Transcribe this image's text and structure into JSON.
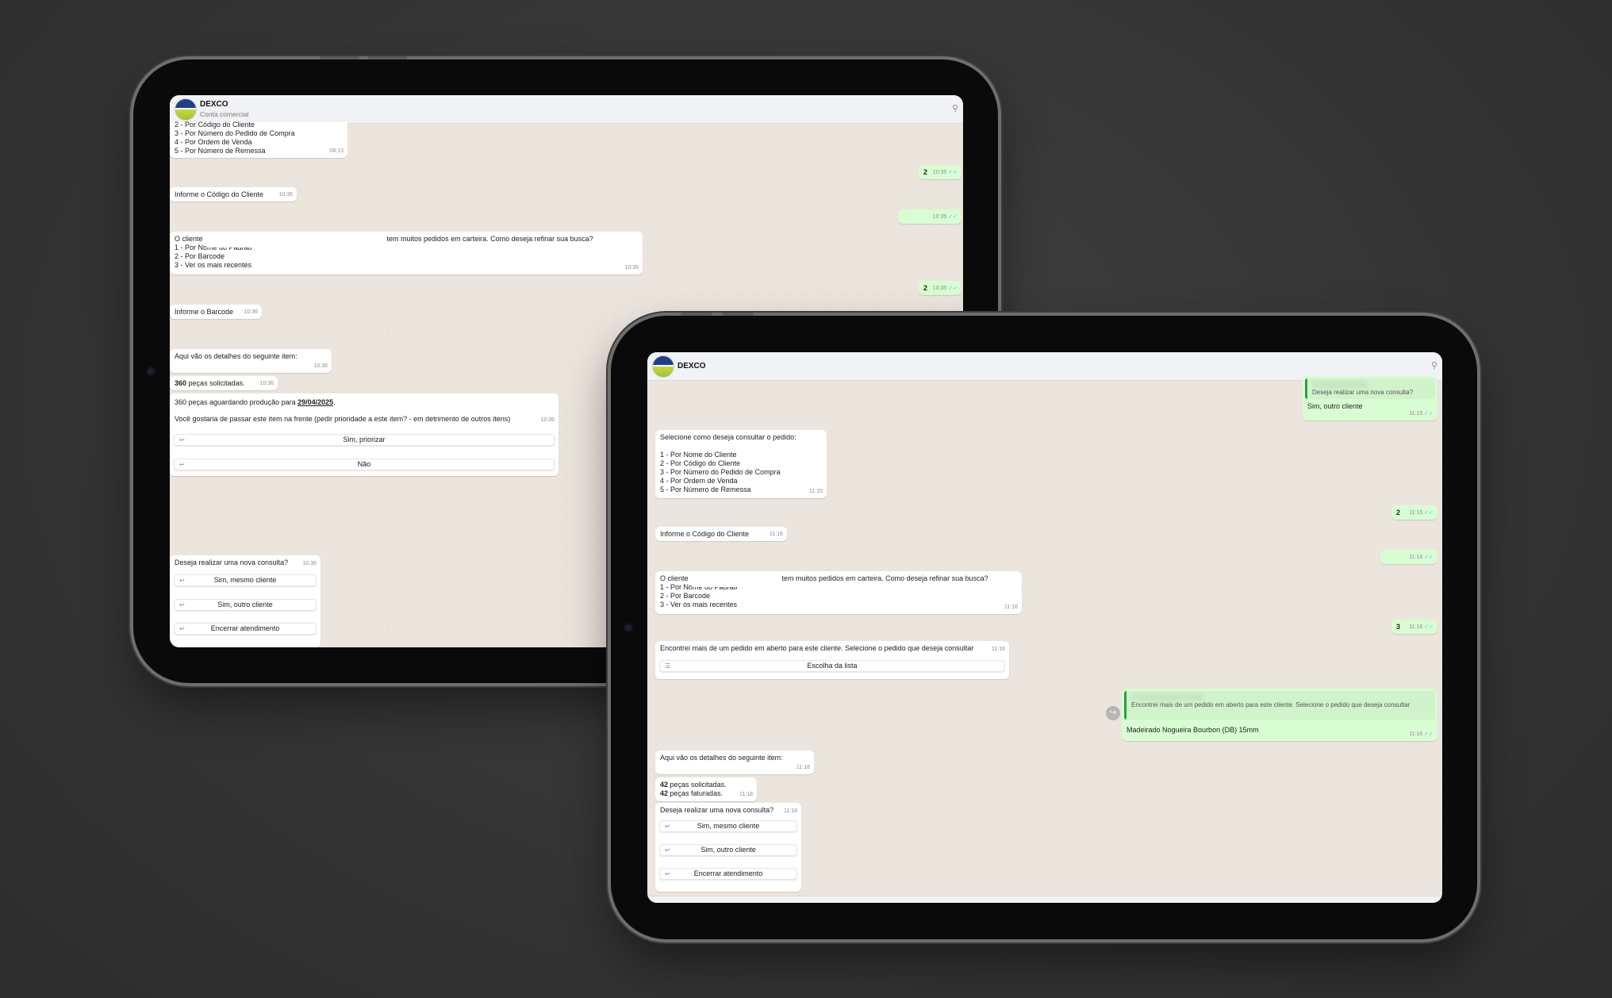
{
  "tablet1": {
    "header": {
      "name": "DEXCO",
      "subtitle": "Conta comercial"
    },
    "msgs": {
      "menu_tail": [
        "2 - Por Código do Cliente",
        "3 - Por Número do Pedido de Compra",
        "4 - Por Ordem de Venda",
        "5 - Por Número de Remessa"
      ],
      "menu_time": "08:13",
      "out_2a": "2",
      "out_2a_time": "10:35",
      "informe_codigo": "Informe o Código do Cliente",
      "informe_codigo_time": "10:35",
      "out_blank_time": "10:35",
      "refine_prefix": "O cliente",
      "refine_suffix": "tem muitos pedidos em carteira. Como deseja refinar sua busca?",
      "refine_options": [
        "1 - Por Nome do Padrão",
        "2 - Por Barcode",
        "3 - Ver os mais recentes"
      ],
      "refine_time": "10:35",
      "out_2b": "2",
      "out_2b_time": "10:35",
      "informe_barcode": "Informe o Barcode",
      "informe_barcode_time": "10:36",
      "detalhes": "Aqui vão os detalhes do seguinte item:",
      "detalhes_time": "10:36",
      "solicitadas_num": "360",
      "solicitadas_text": "peças solicitadas.",
      "solicitadas_time": "10:36",
      "aguardando_prefix": "360 peças aguardando produção para",
      "aguardando_date": "29/04/2025",
      "aguardando_suffix": ".",
      "prioridade_q": "Você gostaria de passar este item na frente (pedir prioridade a este item? - em detrimento de outros itens)",
      "prioridade_time": "10:36",
      "btn_priorizar": "Sim, priorizar",
      "btn_nao": "Não",
      "nova_consulta": "Deseja realizar uma nova consulta?",
      "nova_consulta_time": "10:36",
      "btn_mesmo": "Sim, mesmo cliente",
      "btn_outro": "Sim, outro cliente",
      "btn_encerrar": "Encerrar atendimento"
    }
  },
  "tablet2": {
    "header": {
      "name": "DEXCO"
    },
    "msgs": {
      "reply_quote": "Deseja realizar uma nova consulta?",
      "reply_text": "Sim, outro cliente",
      "reply_time": "11:15",
      "selecione": "Selecione como deseja consultar o pedido:",
      "selecione_options": [
        "1 - Por Nome do Cliente",
        "2 - Por Código do Cliente",
        "3 - Por Número do Pedido de Compra",
        "4 - Por Ordem de Venda",
        "5 - Por Número de Remessa"
      ],
      "selecione_time": "11:15",
      "out_2": "2",
      "out_2_time": "11:15",
      "informe_codigo": "Informe o Código do Cliente",
      "informe_codigo_time": "11:16",
      "out_blank_time": "11:16",
      "refine_prefix": "O cliente",
      "refine_suffix": "tem muitos pedidos em carteira. Como deseja refinar sua busca?",
      "refine_options": [
        "1 - Por Nome do Padrão",
        "2 - Por Barcode",
        "3 - Ver os mais recentes"
      ],
      "refine_time": "11:16",
      "out_3": "3",
      "out_3_time": "11:16",
      "encontrei": "Encontrei mais de um pedido em aberto para este cliente. Selecione o pedido que deseja consultar",
      "encontrei_time": "11:16",
      "btn_lista": "Escolha da lista",
      "reply2_quote": "Encontrei mais de um pedido em aberto para este cliente. Selecione o pedido que deseja consultar",
      "reply2_text": "Madeirado Nogueira Bourbon (DB) 15mm",
      "reply2_time": "11:18",
      "detalhes": "Aqui vão os detalhes do seguinte item:",
      "detalhes_time": "11:18",
      "solicitadas_num": "42",
      "solicitadas_text": "peças solicitadas.",
      "faturadas_num": "42",
      "faturadas_text": "peças faturadas.",
      "pecas_time": "11:18",
      "nova_consulta": "Deseja realizar uma nova consulta?",
      "nova_consulta_time": "11:18",
      "btn_mesmo": "Sim, mesmo cliente",
      "btn_outro": "Sim, outro cliente",
      "btn_encerrar": "Encerrar atendimento"
    }
  },
  "icons": {
    "search": "search-icon",
    "reply": "reply-icon",
    "list": "list-icon",
    "ticks": "double-check-icon",
    "forward": "forward-icon"
  }
}
